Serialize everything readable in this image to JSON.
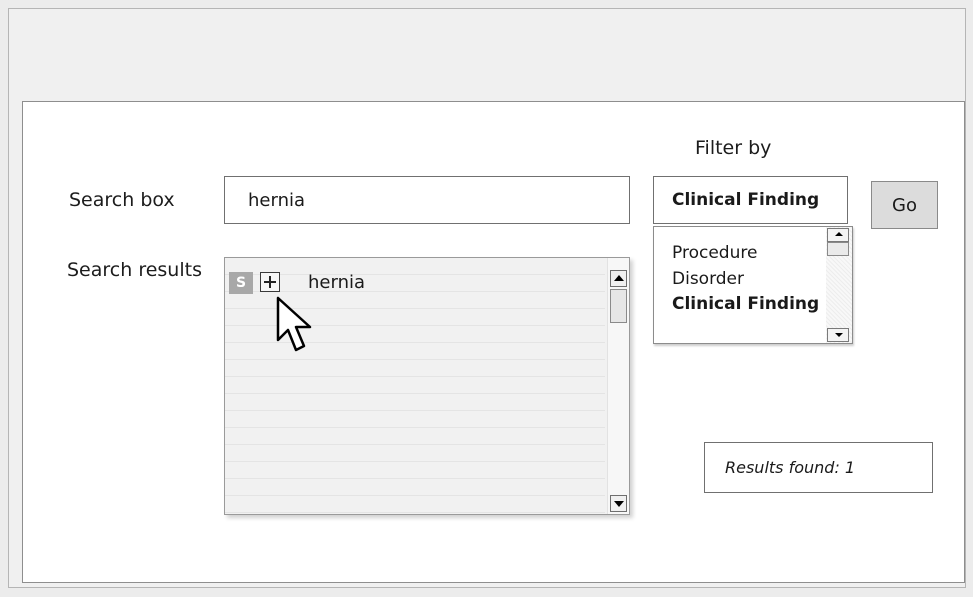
{
  "labels": {
    "search_box": "Search box",
    "search_results": "Search results",
    "filter_by": "Filter by"
  },
  "search": {
    "value": "hernia"
  },
  "results": {
    "items": [
      {
        "badge": "S",
        "text": "hernia",
        "expand_icon": "plus-box-icon"
      }
    ]
  },
  "filter": {
    "selected": "Clinical Finding",
    "options": [
      {
        "label": "Procedure",
        "selected": false
      },
      {
        "label": "Disorder",
        "selected": false
      },
      {
        "label": "Clinical Finding",
        "selected": true
      }
    ]
  },
  "go_button": {
    "label": "Go"
  },
  "status": {
    "results_found": "Results found: 1"
  },
  "colors": {
    "badge_bg": "#a8a8a8",
    "button_bg": "#dcdcdc",
    "window_bg": "#f0f0f0"
  },
  "icons": {
    "cursor": "pointer-cursor-icon",
    "scroll_up": "arrow-up-icon",
    "scroll_down": "arrow-down-icon"
  }
}
